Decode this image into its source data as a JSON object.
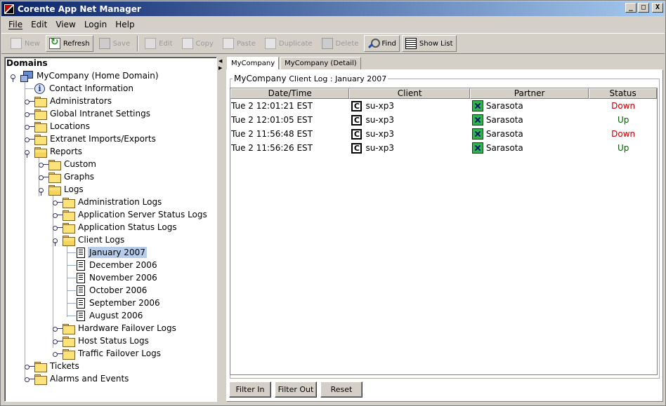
{
  "window": {
    "title": "Corente App Net Manager",
    "controls": [
      "_",
      "□",
      "X"
    ]
  },
  "menu": {
    "items": [
      "File",
      "Edit",
      "View",
      "Login",
      "Help"
    ]
  },
  "toolbar": {
    "new": "New",
    "refresh": "Refresh",
    "save": "Save",
    "edit": "Edit",
    "copy": "Copy",
    "paste": "Paste",
    "duplicate": "Duplicate",
    "delete": "Delete",
    "find": "Find",
    "show_list": "Show List"
  },
  "tree": {
    "title": "Domains",
    "nodes": [
      {
        "label": "MyCompany (Home Domain)",
        "icon": "domain"
      },
      {
        "label": "Contact Information",
        "icon": "info"
      },
      {
        "label": "Administrators",
        "icon": "folder"
      },
      {
        "label": "Global Intranet Settings",
        "icon": "folder"
      },
      {
        "label": "Locations",
        "icon": "folder"
      },
      {
        "label": "Extranet Imports/Exports",
        "icon": "folder"
      },
      {
        "label": "Reports",
        "icon": "folder-open"
      },
      {
        "label": "Custom",
        "icon": "folder"
      },
      {
        "label": "Graphs",
        "icon": "folder"
      },
      {
        "label": "Logs",
        "icon": "folder-open"
      },
      {
        "label": "Administration Logs",
        "icon": "folder"
      },
      {
        "label": "Application Server Status Logs",
        "icon": "folder"
      },
      {
        "label": "Application Status Logs",
        "icon": "folder"
      },
      {
        "label": "Client Logs",
        "icon": "folder-open"
      },
      {
        "label": "January 2007",
        "icon": "page",
        "selected": true
      },
      {
        "label": "December 2006",
        "icon": "page"
      },
      {
        "label": "November 2006",
        "icon": "page"
      },
      {
        "label": "October 2006",
        "icon": "page"
      },
      {
        "label": "September 2006",
        "icon": "page"
      },
      {
        "label": "August 2006",
        "icon": "page"
      },
      {
        "label": "Hardware Failover Logs",
        "icon": "folder"
      },
      {
        "label": "Host Status Logs",
        "icon": "folder"
      },
      {
        "label": "Traffic Failover Logs",
        "icon": "folder"
      },
      {
        "label": "Tickets",
        "icon": "folder"
      },
      {
        "label": "Alarms and Events",
        "icon": "folder"
      }
    ]
  },
  "tabs": [
    "MyCompany",
    "MyCompany (Detail)"
  ],
  "panel": {
    "title_prefix": "MyCompany",
    "title_suffix": "Client Log : January 2007"
  },
  "table": {
    "headers": [
      "Date/Time",
      "Client",
      "Partner",
      "Status"
    ],
    "rows": [
      {
        "datetime": "Tue 2 12:01:21 EST",
        "client_icon": "C",
        "client": "su-xp3",
        "partner": "Sarasota",
        "status": "Down"
      },
      {
        "datetime": "Tue 2 12:01:05 EST",
        "client_icon": "C",
        "client": "su-xp3",
        "partner": "Sarasota",
        "status": "Up"
      },
      {
        "datetime": "Tue 2 11:56:48 EST",
        "client_icon": "C",
        "client": "su-xp3",
        "partner": "Sarasota",
        "status": "Down"
      },
      {
        "datetime": "Tue 2 11:56:26 EST",
        "client_icon": "C",
        "client": "su-xp3",
        "partner": "Sarasota",
        "status": "Up"
      }
    ]
  },
  "buttons": {
    "filter_in": "Filter In",
    "filter_out": "Filter Out",
    "reset": "Reset"
  },
  "colors": {
    "status_down": "#c00000",
    "status_up": "#006000",
    "selection": "#b6cce8",
    "titlebar": "#0a246a"
  }
}
